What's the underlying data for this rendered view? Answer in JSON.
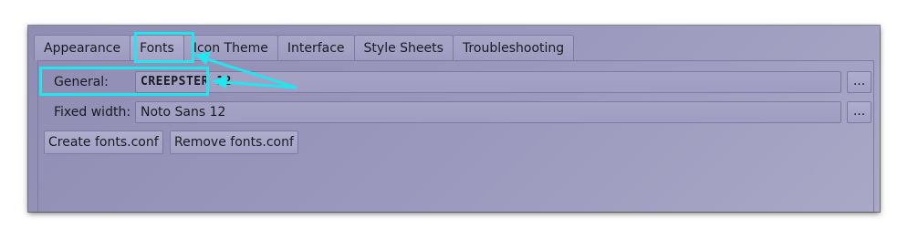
{
  "tabs": [
    {
      "label": "Appearance",
      "active": false
    },
    {
      "label": "Fonts",
      "active": true
    },
    {
      "label": "Icon Theme",
      "active": false
    },
    {
      "label": "Interface",
      "active": false
    },
    {
      "label": "Style Sheets",
      "active": false
    },
    {
      "label": "Troubleshooting",
      "active": false
    }
  ],
  "fonts": {
    "general_label": "General:",
    "general_value": "CREEPSTER 12",
    "fixed_label": "Fixed width:",
    "fixed_value": "Noto Sans 12",
    "browse_label": "..."
  },
  "buttons": {
    "create": "Create  fonts.conf",
    "remove": "Remove fonts.conf"
  },
  "colors": {
    "highlight": "#22e6ef",
    "window_bg": "#9b99bd"
  }
}
